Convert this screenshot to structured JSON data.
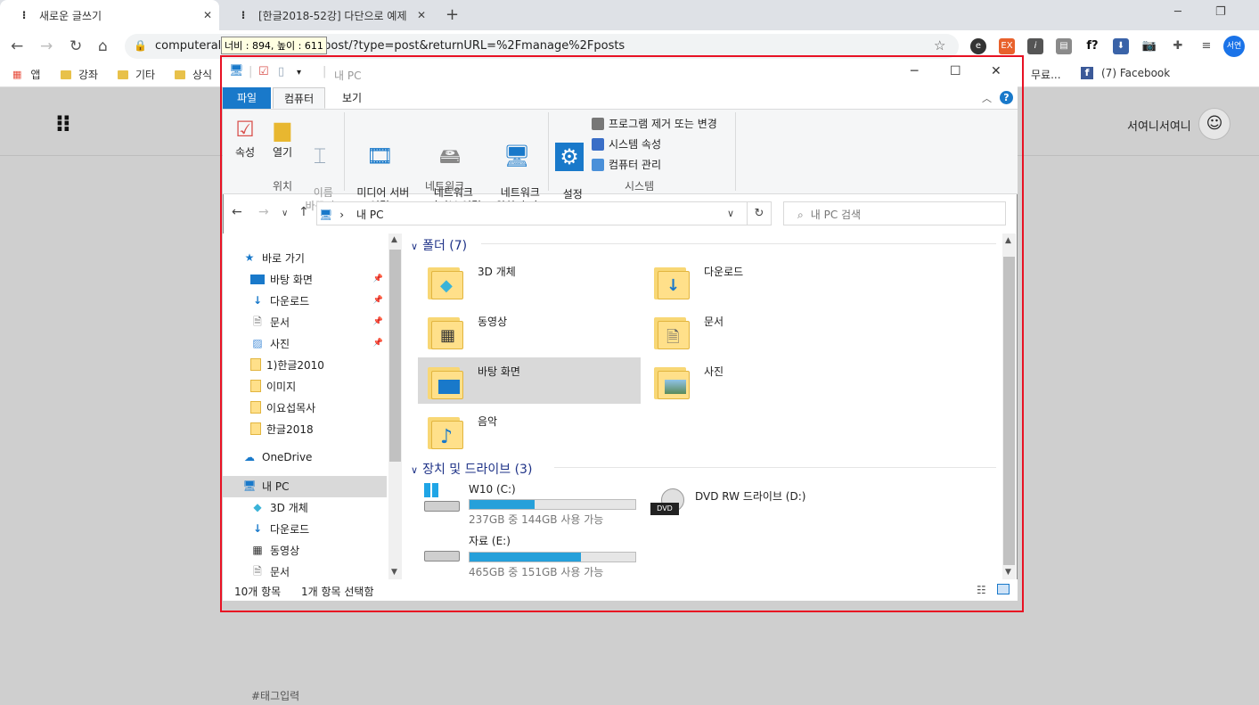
{
  "browser": {
    "tabs": [
      {
        "title": "새로운 글쓰기",
        "icon": "tistory-icon"
      },
      {
        "title": "[한글2018-52강] 다단으로 예제",
        "icon": "tistory-icon"
      }
    ],
    "url_start": "computerall",
    "url_rest": "e/newpost/?type=post&returnURL=%2Fmanage%2Fposts",
    "size_tooltip": "너비 : 894, 높이 : 611",
    "avatar_text": "서연",
    "bookmarks": [
      "앱",
      "강좌",
      "기타",
      "상식",
      "무료...",
      "(7) Facebook"
    ]
  },
  "page": {
    "user_name": "서여니서여니",
    "tag_placeholder": "#태그입력"
  },
  "explorer": {
    "title": "내 PC",
    "ribbon_tabs": [
      "파일",
      "컴퓨터",
      "보기"
    ],
    "ribbon": {
      "location": {
        "group": "위치",
        "buttons": [
          "속성",
          "열기",
          "이름\n바꾸기"
        ]
      },
      "network": {
        "group": "네트워크",
        "buttons": [
          "미디어 서버\n연결",
          "네트워크\n드라이브 연결",
          "네트워크\n위치 추가"
        ]
      },
      "system": {
        "group": "시스템",
        "open_settings": "설정\n열기",
        "items": [
          "프로그램 제거 또는 변경",
          "시스템 속성",
          "컴퓨터 관리"
        ]
      }
    },
    "address": "내 PC",
    "search_placeholder": "내 PC 검색",
    "nav": {
      "quick_access": "바로 가기",
      "pinned": [
        "바탕 화면",
        "다운로드",
        "문서",
        "사진"
      ],
      "folders": [
        "1)한글2010",
        "이미지",
        "이요섭목사",
        "한글2018"
      ],
      "onedrive": "OneDrive",
      "this_pc": "내 PC",
      "pc_children": [
        "3D 개체",
        "다운로드",
        "동영상",
        "문서"
      ]
    },
    "folders_section": {
      "title": "폴더",
      "count": "(7)"
    },
    "folders": [
      "3D 개체",
      "다운로드",
      "동영상",
      "문서",
      "바탕 화면",
      "사진",
      "음악"
    ],
    "drives_section": {
      "title": "장치 및 드라이브",
      "count": "(3)"
    },
    "drives": [
      {
        "name": "W10 (C:)",
        "info": "237GB 중 144GB 사용 가능",
        "used_pct": 39
      },
      {
        "name": "DVD RW 드라이브 (D:)"
      },
      {
        "name": "자료 (E:)",
        "info": "465GB 중 151GB 사용 가능",
        "used_pct": 67
      }
    ],
    "status_items": "10개 항목",
    "status_selected": "1개 항목 선택함"
  }
}
